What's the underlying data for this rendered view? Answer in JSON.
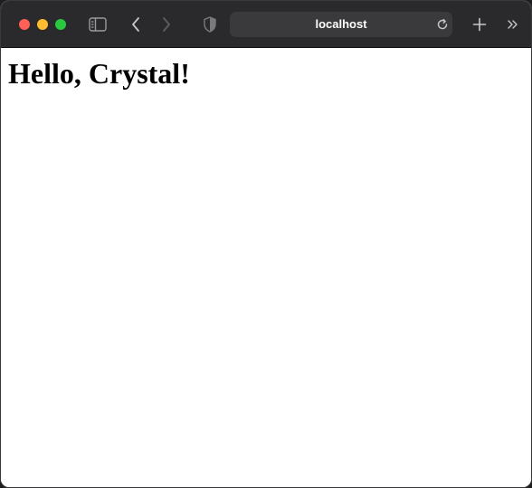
{
  "browser": {
    "address": "localhost",
    "colors": {
      "toolbar": "#2a2a2c",
      "address_bar": "#3a3a3c",
      "traffic_close": "#fe5f57",
      "traffic_minimize": "#febc2e",
      "traffic_zoom": "#28c840"
    },
    "icons": {
      "sidebar": "sidebar-icon",
      "back": "chevron-left-icon",
      "forward": "chevron-right-icon",
      "privacy": "shield-icon",
      "reload": "reload-icon",
      "new_tab": "plus-icon",
      "more": "double-chevron-right-icon"
    }
  },
  "page": {
    "heading": "Hello, Crystal!"
  }
}
